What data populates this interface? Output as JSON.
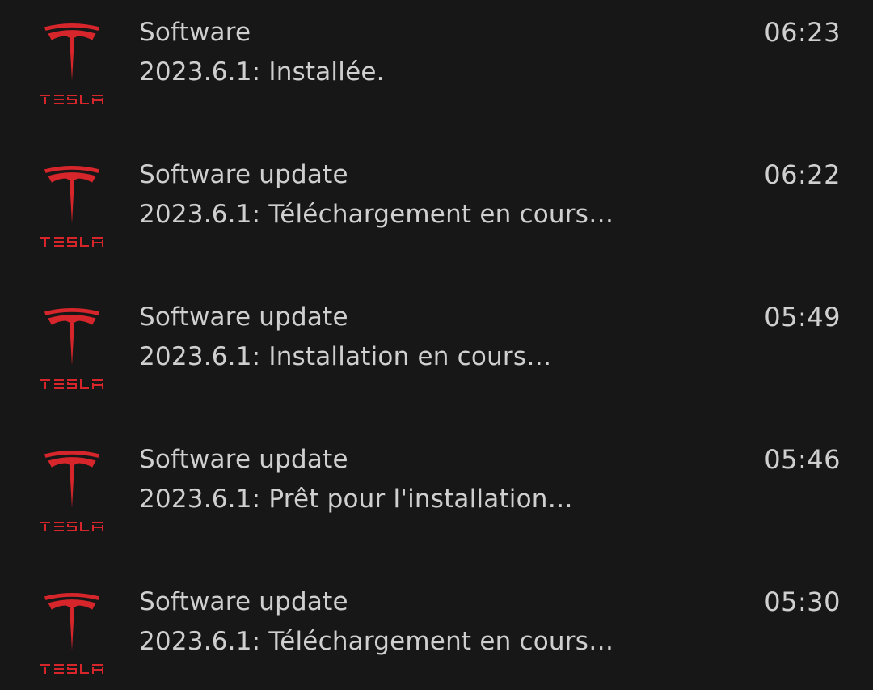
{
  "brand_color": "#d6262b",
  "logo": {
    "icon": "tesla-logo-icon",
    "wordmark": "TESLA"
  },
  "notifications": [
    {
      "title": "Software",
      "message": "2023.6.1: Installée.",
      "time": "06:23"
    },
    {
      "title": "Software update",
      "message": "2023.6.1: Téléchargement en cours…",
      "time": "06:22"
    },
    {
      "title": "Software update",
      "message": "2023.6.1: Installation en cours…",
      "time": "05:49"
    },
    {
      "title": "Software update",
      "message": "2023.6.1: Prêt pour l'installation…",
      "time": "05:46"
    },
    {
      "title": "Software update",
      "message": "2023.6.1: Téléchargement en cours…",
      "time": "05:30"
    }
  ]
}
